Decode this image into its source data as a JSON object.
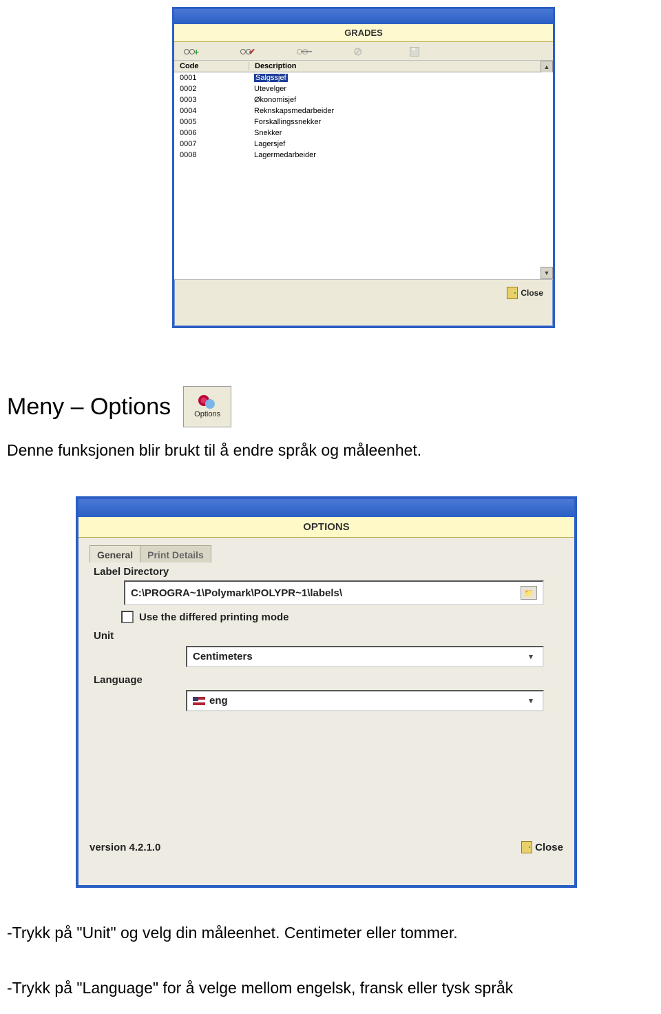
{
  "grades_window": {
    "title": "GRADES",
    "columns": {
      "code": "Code",
      "description": "Description"
    },
    "rows": [
      {
        "code": "0001",
        "description": "Salgssjef"
      },
      {
        "code": "0002",
        "description": "Utevelger"
      },
      {
        "code": "0003",
        "description": "Økonomisjef"
      },
      {
        "code": "0004",
        "description": "Reknskapsmedarbeider"
      },
      {
        "code": "0005",
        "description": "Forskallingssnekker"
      },
      {
        "code": "0006",
        "description": "Snekker"
      },
      {
        "code": "0007",
        "description": "Lagersjef"
      },
      {
        "code": "0008",
        "description": "Lagermedarbeider"
      }
    ],
    "close_label": "Close"
  },
  "heading": "Meny – Options",
  "options_button_label": "Options",
  "intro_text": "Denne funksjonen blir brukt til å endre språk og måleenhet.",
  "options_window": {
    "title": "OPTIONS",
    "tabs": {
      "general": "General",
      "print": "Print Details"
    },
    "label_directory_label": "Label Directory",
    "label_directory_value": "C:\\PROGRA~1\\Polymark\\POLYPR~1\\labels\\",
    "use_diff_mode_label": "Use the differed printing mode",
    "unit_label": "Unit",
    "unit_value": "Centimeters",
    "language_label": "Language",
    "language_value": "eng",
    "version_label": "version 4.2.1.0",
    "close_label": "Close"
  },
  "hint_unit": "-Trykk på \"Unit\" og velg din måleenhet. Centimeter eller tommer.",
  "hint_language": "-Trykk på \"Language\" for å velge mellom engelsk, fransk eller tysk språk"
}
